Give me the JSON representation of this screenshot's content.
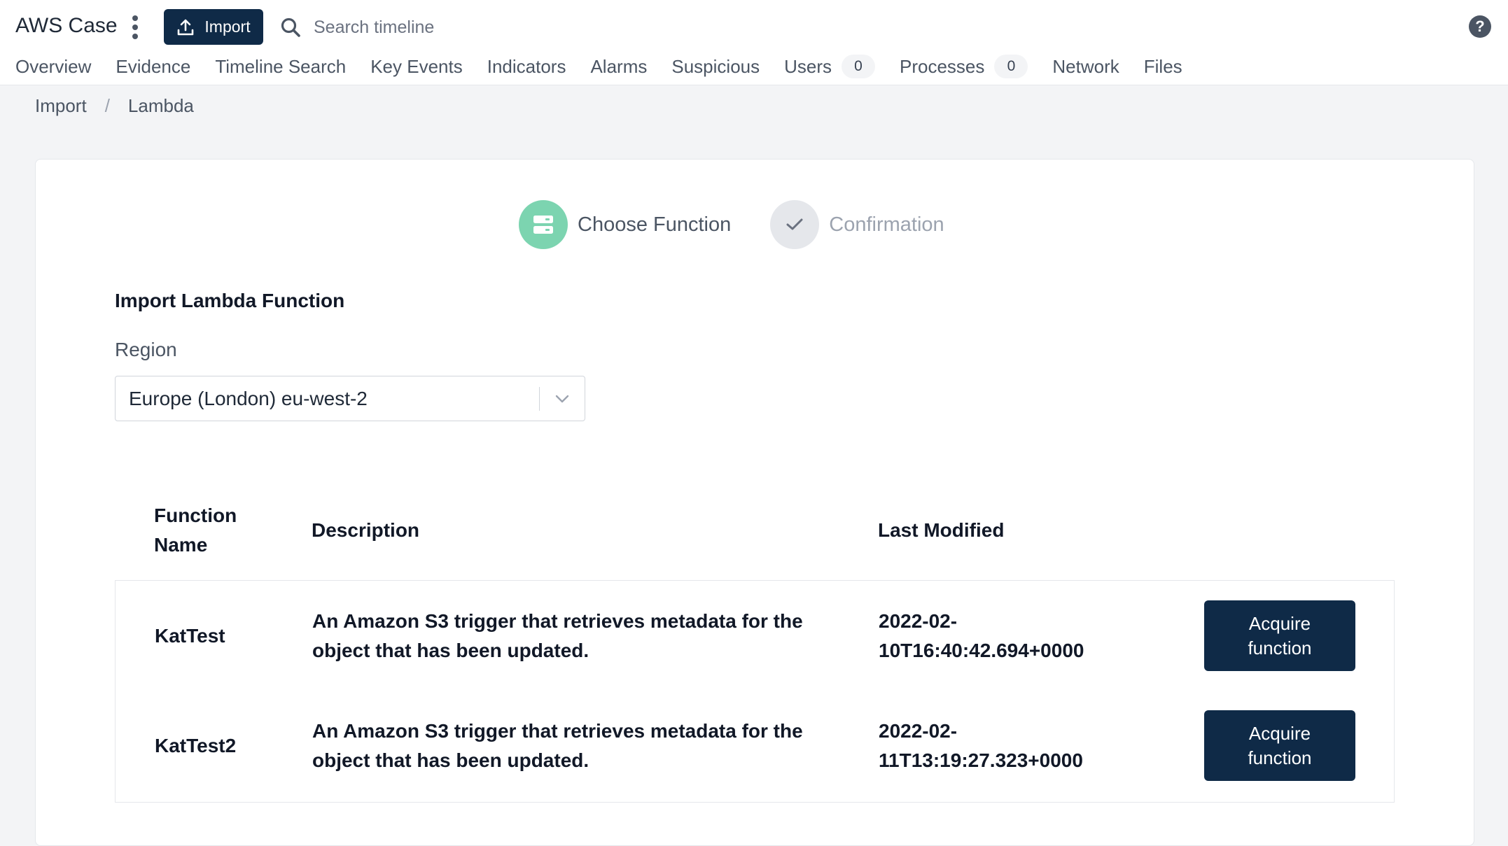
{
  "app": {
    "title": "AWS Case"
  },
  "toolbar": {
    "import_label": "Import",
    "search_placeholder": "Search timeline"
  },
  "nav": [
    {
      "label": "Overview"
    },
    {
      "label": "Evidence"
    },
    {
      "label": "Timeline Search"
    },
    {
      "label": "Key Events"
    },
    {
      "label": "Indicators"
    },
    {
      "label": "Alarms"
    },
    {
      "label": "Suspicious"
    },
    {
      "label": "Users",
      "count": "0"
    },
    {
      "label": "Processes",
      "count": "0"
    },
    {
      "label": "Network"
    },
    {
      "label": "Files"
    }
  ],
  "breadcrumb": {
    "items": [
      "Import",
      "Lambda"
    ],
    "separator": "/"
  },
  "stepper": {
    "steps": [
      "Choose Function",
      "Confirmation"
    ]
  },
  "form": {
    "title": "Import Lambda Function",
    "region_label": "Region",
    "region_value": "Europe (London) eu-west-2"
  },
  "table": {
    "headers": [
      "Function Name",
      "Description",
      "Last Modified"
    ],
    "rows": [
      {
        "name": "KatTest",
        "description": "An Amazon S3 trigger that retrieves metadata for the object that has been updated.",
        "last_modified": "2022-02-10T16:40:42.694+0000",
        "action": "Acquire function"
      },
      {
        "name": "KatTest2",
        "description": "An Amazon S3 trigger that retrieves metadata for the object that has been updated.",
        "last_modified": "2022-02-11T13:19:27.323+0000",
        "action": "Acquire function"
      }
    ]
  },
  "colors": {
    "primary": "#0f2a47",
    "step_active": "#7cd4b0",
    "background": "#f3f4f6"
  },
  "icons": [
    "kebab-menu-icon",
    "upload-icon",
    "search-icon",
    "help-icon",
    "server-icon",
    "check-icon",
    "chevron-down-icon"
  ]
}
